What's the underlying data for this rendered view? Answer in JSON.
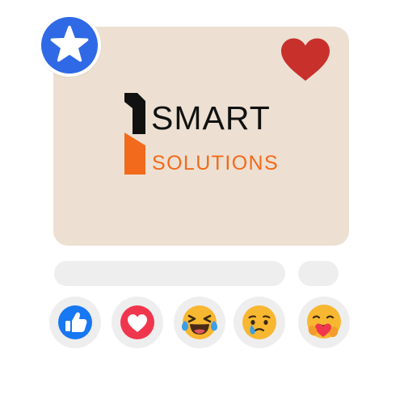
{
  "post": {
    "badge_icon": "star-icon",
    "favorite_icon": "heart-icon",
    "logo": {
      "line1": "SMART",
      "line2": "SOLUTIONS"
    }
  },
  "reactions": [
    {
      "name": "like",
      "icon": "thumbs-up-icon"
    },
    {
      "name": "love",
      "icon": "heart-reaction-icon"
    },
    {
      "name": "haha",
      "icon": "laughing-face-icon"
    },
    {
      "name": "sad",
      "icon": "crying-face-icon"
    },
    {
      "name": "care",
      "icon": "hugging-face-icon"
    }
  ],
  "colors": {
    "card_bg": "#ede0d2",
    "badge_blue": "#2f69e5",
    "heart_red": "#c8302c",
    "brand_orange": "#f26a1b",
    "like_blue": "#1877f2",
    "love_red": "#f0364d",
    "emoji_yellow": "#f7b731",
    "placeholder_gray": "#eeeeee"
  }
}
